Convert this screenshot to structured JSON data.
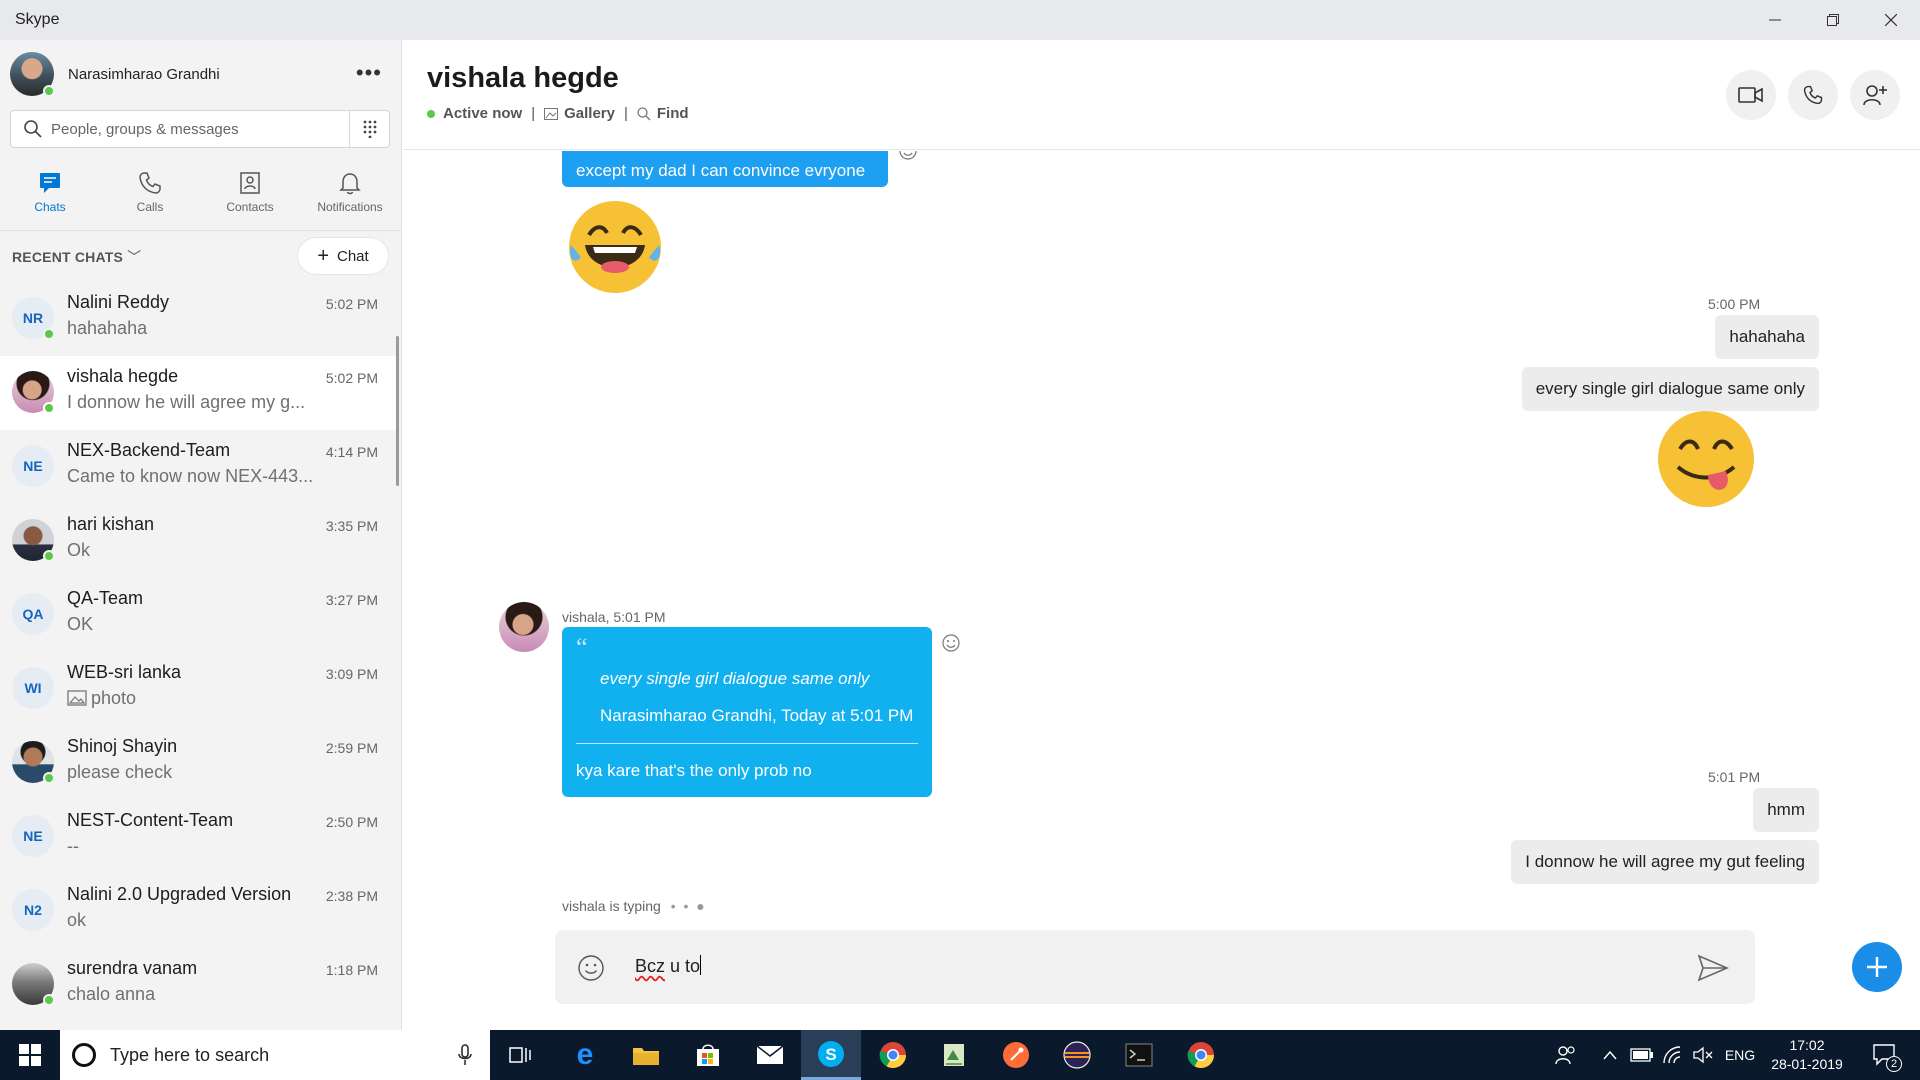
{
  "window": {
    "title": "Skype"
  },
  "profile": {
    "name": "Narasimharao Grandhi"
  },
  "search": {
    "placeholder": "People, groups & messages"
  },
  "nav": {
    "tabs": [
      {
        "label": "Chats",
        "icon": "chat-icon",
        "active": true
      },
      {
        "label": "Calls",
        "icon": "phone-icon",
        "active": false
      },
      {
        "label": "Contacts",
        "icon": "contacts-icon",
        "active": false
      },
      {
        "label": "Notifications",
        "icon": "bell-icon",
        "active": false
      }
    ]
  },
  "recent": {
    "label": "RECENT CHATS",
    "new_chat_label": "Chat"
  },
  "chats": [
    {
      "initials": "NR",
      "name": "Nalini Reddy",
      "time": "5:02 PM",
      "preview": "hahahaha",
      "online": true,
      "photo": false,
      "selected": false
    },
    {
      "initials": "",
      "name": "vishala hegde",
      "time": "5:02 PM",
      "preview": "I donnow he will agree my g...",
      "online": true,
      "photo": true,
      "selected": true
    },
    {
      "initials": "NE",
      "name": "NEX-Backend-Team",
      "time": "4:14 PM",
      "preview": "Came to know now NEX-443...",
      "online": false,
      "photo": false,
      "selected": false
    },
    {
      "initials": "",
      "name": "hari kishan",
      "time": "3:35 PM",
      "preview": "Ok",
      "online": true,
      "photo": true,
      "selected": false
    },
    {
      "initials": "QA",
      "name": "QA-Team",
      "time": "3:27 PM",
      "preview": "OK",
      "online": false,
      "photo": false,
      "selected": false
    },
    {
      "initials": "WI",
      "name": "WEB-sri lanka",
      "time": "3:09 PM",
      "preview": "photo",
      "online": false,
      "photo": false,
      "selected": false
    },
    {
      "initials": "",
      "name": "Shinoj Shayin",
      "time": "2:59 PM",
      "preview": "please check",
      "online": true,
      "photo": true,
      "selected": false
    },
    {
      "initials": "NE",
      "name": "NEST-Content-Team",
      "time": "2:50 PM",
      "preview": "--",
      "online": false,
      "photo": false,
      "selected": false
    },
    {
      "initials": "N2",
      "name": "Nalini 2.0 Upgraded Version",
      "time": "2:38 PM",
      "preview": "ok",
      "online": false,
      "photo": false,
      "selected": false
    },
    {
      "initials": "",
      "name": "surendra vanam",
      "time": "1:18 PM",
      "preview": "chalo anna",
      "online": true,
      "photo": true,
      "selected": false
    }
  ],
  "conversation": {
    "title": "vishala hegde",
    "status": "Active now",
    "gallery_label": "Gallery",
    "find_label": "Find",
    "msg_convince": "except my dad I can convince evryone",
    "time_1": "5:00 PM",
    "msg_hahahaha": "hahahaha",
    "msg_every_single": "every single girl dialogue same only",
    "sender_line": "vishala, 5:01 PM",
    "quote_text": "every single girl dialogue same only",
    "quote_author": "Narasimharao Grandhi, Today at 5:01 PM",
    "reply_text": "kya kare that's the only prob no",
    "time_2": "5:01 PM",
    "msg_hmm": "hmm",
    "msg_donnow": "I donnow he will agree my gut feeling",
    "typing": "vishala is typing"
  },
  "composer": {
    "text_part1": "Bcz",
    "text_part2": " u to"
  },
  "taskbar": {
    "search_placeholder": "Type here to search",
    "lang": "ENG",
    "time": "17:02",
    "date": "28-01-2019",
    "notification_count": "2"
  },
  "colors": {
    "accent": "#0078d4",
    "bubble_in": "#1ea0f2",
    "online": "#5cc84b"
  }
}
